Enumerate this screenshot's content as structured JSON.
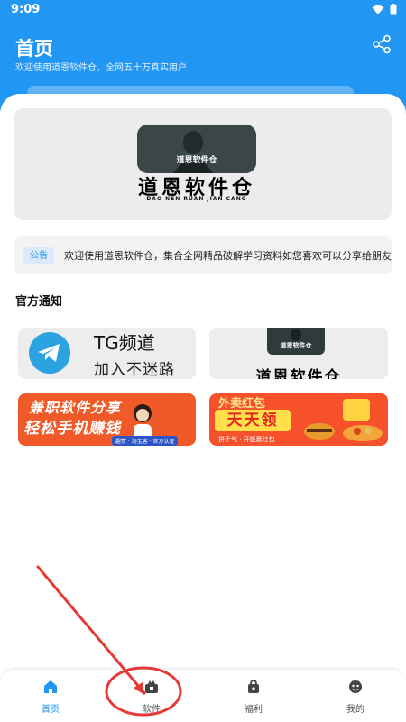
{
  "status_bar": {
    "time": "9:09"
  },
  "header": {
    "title": "首页",
    "subtitle": "欢迎使用道恩软件仓，全网五十万真实用户",
    "share_icon": "share-icon"
  },
  "banner": {
    "logo_caption": "道恩软件仓",
    "title": "道恩软件仓",
    "subtitle": "DAO NEN  RUAN JIAN CANG"
  },
  "notice": {
    "tag": "公告",
    "text": "欢迎使用道恩软件仓，集合全网精品破解学习资料如您喜欢可以分享给朋友"
  },
  "official": {
    "title": "官方通知",
    "tiles": [
      {
        "title": "TG频道",
        "subtitle": "加入不迷路",
        "icon": "telegram-icon"
      },
      {
        "caption": "道恩软件仓",
        "title": "道恩软件仓"
      },
      {
        "line1": "兼职软件分享",
        "line2": "轻松手机赚钱",
        "chips": "趣赞 · 淘宝客 · 官方认证"
      },
      {
        "line1": "外卖红包",
        "line2": "天天领",
        "line3": "拼手气 · 开饭赢红包"
      }
    ]
  },
  "bottom_nav": {
    "active": "home",
    "items": [
      {
        "label": "首页",
        "icon": "home-icon"
      },
      {
        "label": "软件",
        "icon": "software-bag-icon"
      },
      {
        "label": "福利",
        "icon": "gift-bag-icon"
      },
      {
        "label": "我的",
        "icon": "profile-icon"
      }
    ]
  },
  "colors": {
    "primary": "#2196F3",
    "annotation": "#e53935"
  }
}
